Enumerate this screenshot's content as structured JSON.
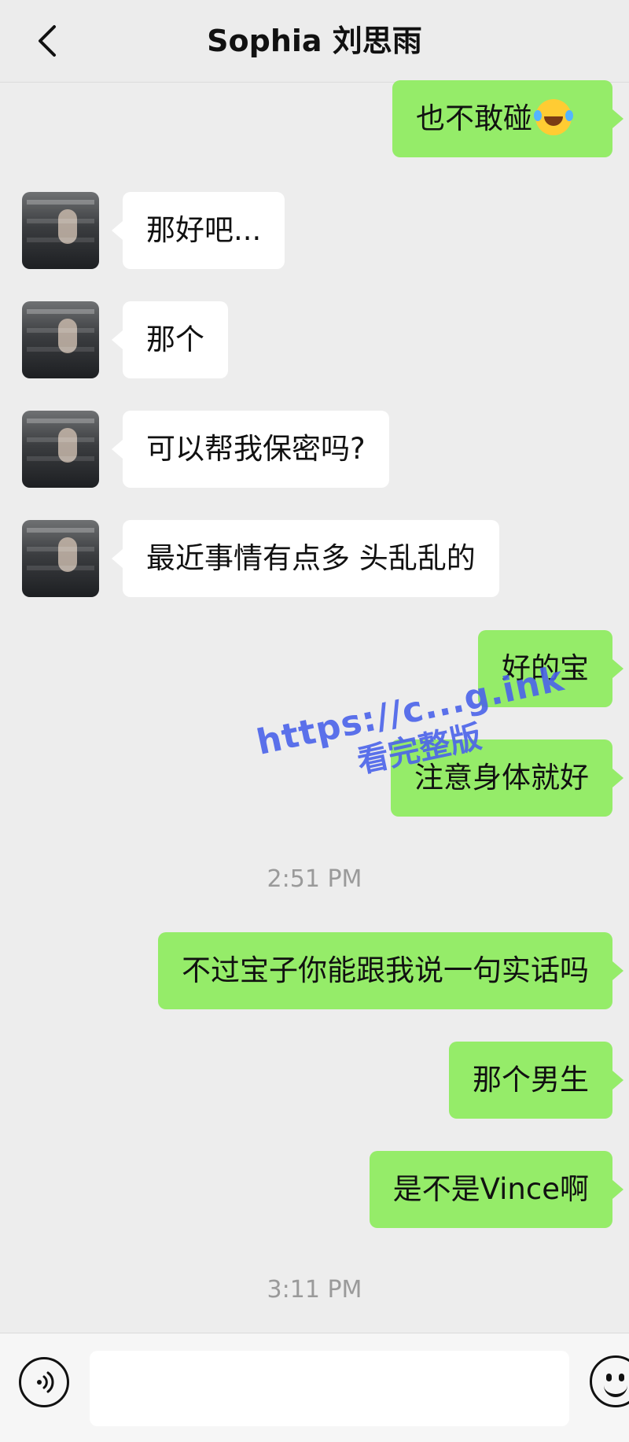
{
  "header": {
    "title": "Sophia 刘思雨"
  },
  "messages": [
    {
      "side": "out",
      "text": "也不敢碰",
      "emoji": "laughing-tears-emoji"
    },
    {
      "side": "in",
      "text": "那好吧..."
    },
    {
      "side": "in",
      "text": "那个"
    },
    {
      "side": "in",
      "text": "可以帮我保密吗?"
    },
    {
      "side": "in",
      "text": "最近事情有点多 头乱乱的"
    },
    {
      "side": "out",
      "text": "好的宝"
    },
    {
      "side": "out",
      "text": "注意身体就好"
    },
    {
      "side": "out",
      "text": "不过宝子你能跟我说一句实话吗"
    },
    {
      "side": "out",
      "text": "那个男生"
    },
    {
      "side": "out",
      "text": "是不是Vince啊"
    }
  ],
  "timestamps": [
    "2:51 PM",
    "3:11 PM"
  ],
  "watermark": {
    "line1": "https://c...g.ink",
    "line2": "看完整版"
  },
  "icons": {
    "back": "chevron-left-icon",
    "voice": "voice-icon",
    "emoji": "emoji-icon"
  },
  "colors": {
    "background": "#ededed",
    "outgoing_bubble": "#95ec69",
    "incoming_bubble": "#ffffff",
    "watermark": "#4b63ea"
  }
}
